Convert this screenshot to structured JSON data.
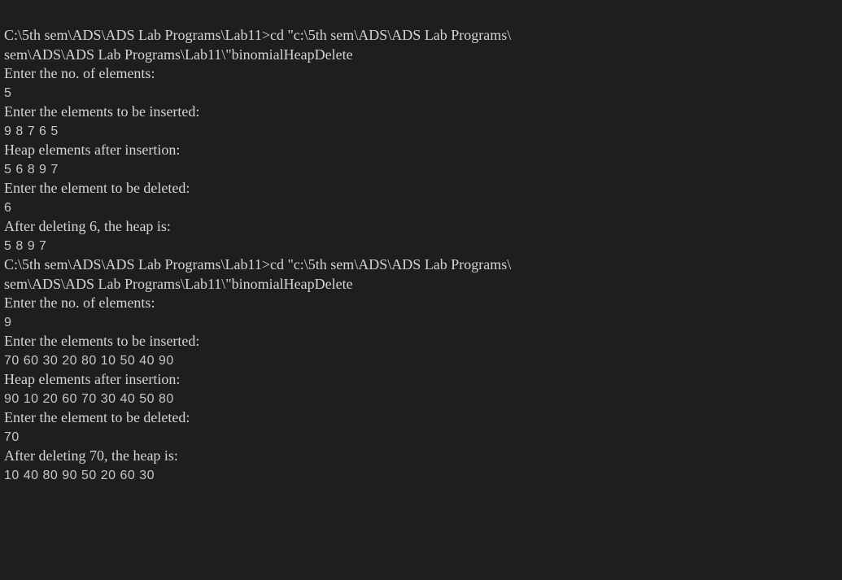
{
  "terminal": {
    "lines": [
      {
        "text": "C:\\5th sem\\ADS\\ADS Lab Programs\\Lab11>cd \"c:\\5th sem\\ADS\\ADS Lab Programs\\",
        "style": "serif"
      },
      {
        "text": "sem\\ADS\\ADS Lab Programs\\Lab11\\\"binomialHeapDelete",
        "style": "serif"
      },
      {
        "text": "Enter the no. of elements:",
        "style": "serif"
      },
      {
        "text": "5",
        "style": "plain"
      },
      {
        "text": "Enter the elements to be inserted:",
        "style": "serif"
      },
      {
        "text": "9 8 7 6 5",
        "style": "plain"
      },
      {
        "text": "Heap elements after insertion:",
        "style": "serif"
      },
      {
        "text": "5 6 8 9 7",
        "style": "plain"
      },
      {
        "text": "Enter the element to be deleted:",
        "style": "serif"
      },
      {
        "text": "6",
        "style": "plain"
      },
      {
        "text": "After deleting 6, the heap is:",
        "style": "serif"
      },
      {
        "text": "5 8 9 7",
        "style": "plain"
      },
      {
        "text": "C:\\5th sem\\ADS\\ADS Lab Programs\\Lab11>cd \"c:\\5th sem\\ADS\\ADS Lab Programs\\",
        "style": "serif"
      },
      {
        "text": "sem\\ADS\\ADS Lab Programs\\Lab11\\\"binomialHeapDelete",
        "style": "serif"
      },
      {
        "text": "Enter the no. of elements:",
        "style": "serif"
      },
      {
        "text": "9",
        "style": "plain"
      },
      {
        "text": "Enter the elements to be inserted:",
        "style": "serif"
      },
      {
        "text": "70 60 30 20 80 10 50 40 90",
        "style": "plain"
      },
      {
        "text": "Heap elements after insertion:",
        "style": "serif"
      },
      {
        "text": "90 10 20 60 70 30 40 50 80",
        "style": "plain"
      },
      {
        "text": "Enter the element to be deleted:",
        "style": "serif"
      },
      {
        "text": "70",
        "style": "plain"
      },
      {
        "text": "After deleting 70, the heap is:",
        "style": "serif"
      },
      {
        "text": "10 40 80 90 50 20 60 30",
        "style": "plain"
      }
    ]
  },
  "colors": {
    "background": "#1e1e1e",
    "text": "#cccccc"
  }
}
